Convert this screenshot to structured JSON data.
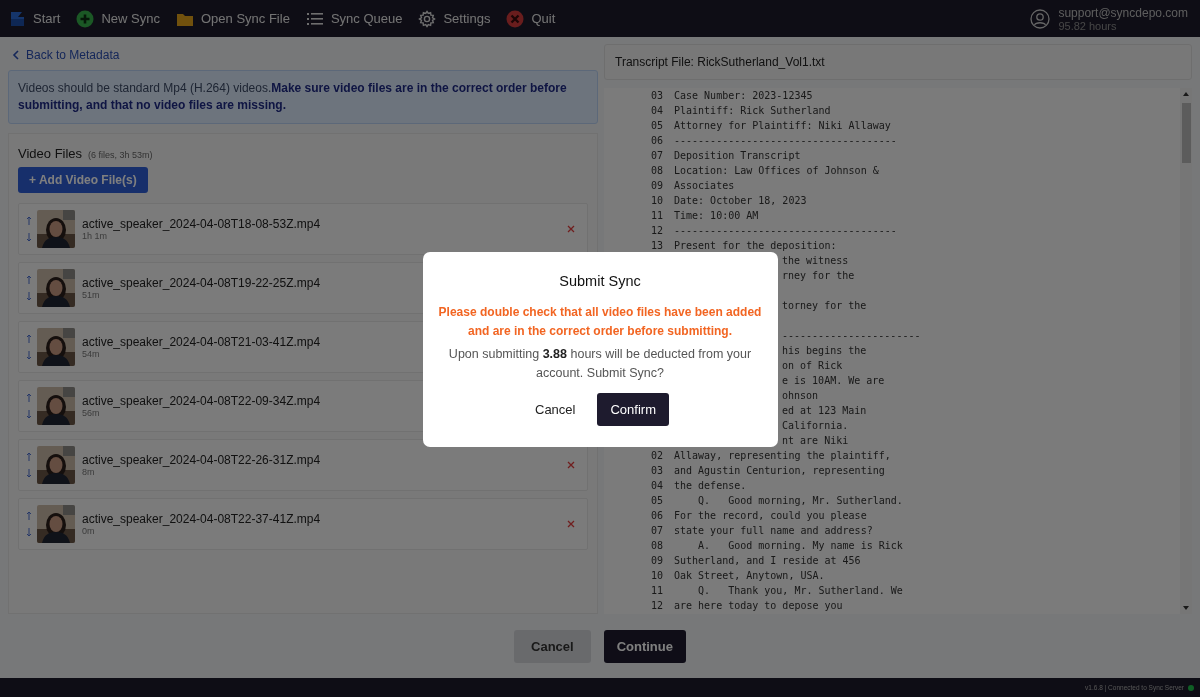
{
  "topbar": {
    "items": [
      {
        "kind": "logo",
        "label": "Start"
      },
      {
        "kind": "new",
        "label": "New Sync"
      },
      {
        "kind": "folder",
        "label": "Open Sync File"
      },
      {
        "kind": "list",
        "label": "Sync Queue"
      },
      {
        "kind": "gear",
        "label": "Settings"
      },
      {
        "kind": "quit",
        "label": "Quit"
      }
    ],
    "account": {
      "email": "support@syncdepo.com",
      "hours": "95.82 hours"
    }
  },
  "back_link": "Back to Metadata",
  "notice": "Videos should be standard Mp4 (H.264) videos.**Make sure video files are in the correct order before submitting, and that no video files are missing.**",
  "video_files": {
    "title": "Video Files",
    "summary": "(6 files, 3h 53m)",
    "add_button": "+ Add Video File(s)",
    "files": [
      {
        "name": "active_speaker_2024-04-08T18-08-53Z.mp4",
        "duration": "1h 1m",
        "remove_button": true
      },
      {
        "name": "active_speaker_2024-04-08T19-22-25Z.mp4",
        "duration": "51m",
        "remove_button": false
      },
      {
        "name": "active_speaker_2024-04-08T21-03-41Z.mp4",
        "duration": "54m",
        "remove_button": false
      },
      {
        "name": "active_speaker_2024-04-08T22-09-34Z.mp4",
        "duration": "56m",
        "remove_button": false
      },
      {
        "name": "active_speaker_2024-04-08T22-26-31Z.mp4",
        "duration": "8m",
        "remove_button": true
      },
      {
        "name": "active_speaker_2024-04-08T22-37-41Z.mp4",
        "duration": "0m",
        "remove_button": true
      }
    ]
  },
  "transcript": {
    "title": "Transcript File: RickSutherland_Vol1.txt",
    "lines": [
      {
        "kind": "line",
        "num": "03",
        "text": "Case Number: 2023-12345"
      },
      {
        "kind": "line",
        "num": "04",
        "text": "Plaintiff: Rick Sutherland"
      },
      {
        "kind": "line",
        "num": "05",
        "text": "Attorney for Plaintiff: Niki Allaway"
      },
      {
        "kind": "line",
        "num": "06",
        "text": "-------------------------------------"
      },
      {
        "kind": "line",
        "num": "07",
        "text": "Deposition Transcript"
      },
      {
        "kind": "line",
        "num": "08",
        "text": "Location: Law Offices of Johnson &"
      },
      {
        "kind": "line",
        "num": "09",
        "text": "Associates"
      },
      {
        "kind": "line",
        "num": "10",
        "text": "Date: October 18, 2023"
      },
      {
        "kind": "line",
        "num": "11",
        "text": "Time: 10:00 AM"
      },
      {
        "kind": "line",
        "num": "12",
        "text": "-------------------------------------"
      },
      {
        "kind": "line",
        "num": "13",
        "text": "Present for the deposition:"
      },
      {
        "kind": "partial",
        "text": "the witness"
      },
      {
        "kind": "partial",
        "text": "rney for the"
      },
      {
        "kind": "blank"
      },
      {
        "kind": "partial",
        "text": "torney for the"
      },
      {
        "kind": "blank"
      },
      {
        "kind": "partial",
        "text": "-----------------------"
      },
      {
        "kind": "partial",
        "text": "his begins the"
      },
      {
        "kind": "partial",
        "text": "on of Rick"
      },
      {
        "kind": "partial",
        "text": "e is 10AM. We are"
      },
      {
        "kind": "partial",
        "text": "ohnson"
      },
      {
        "kind": "partial",
        "text": "ed at 123 Main"
      },
      {
        "kind": "partial",
        "text": "California."
      },
      {
        "kind": "partial",
        "text": "nt are Niki"
      },
      {
        "kind": "line",
        "num": "02",
        "text": "Allaway, representing the plaintiff,"
      },
      {
        "kind": "line",
        "num": "03",
        "text": "and Agustin Centurion, representing"
      },
      {
        "kind": "line",
        "num": "04",
        "text": "the defense."
      },
      {
        "kind": "line",
        "num": "05",
        "text": "    Q.   Good morning, Mr. Sutherland."
      },
      {
        "kind": "line",
        "num": "06",
        "text": "For the record, could you please"
      },
      {
        "kind": "line",
        "num": "07",
        "text": "state your full name and address?"
      },
      {
        "kind": "line",
        "num": "08",
        "text": "    A.   Good morning. My name is Rick"
      },
      {
        "kind": "line",
        "num": "09",
        "text": "Sutherland, and I reside at 456"
      },
      {
        "kind": "line",
        "num": "10",
        "text": "Oak Street, Anytown, USA."
      },
      {
        "kind": "line",
        "num": "11",
        "text": "    Q.   Thank you, Mr. Sutherland. We"
      },
      {
        "kind": "line",
        "num": "12",
        "text": "are here today to depose you"
      }
    ]
  },
  "actions": {
    "cancel": "Cancel",
    "continue": "Continue"
  },
  "footer": {
    "status": "v1.6.8 | Connected to Sync Server",
    "connected": true
  },
  "modal": {
    "title": "Submit Sync",
    "warning": "Please double check that all video files have been added and are in the correct order before submitting.",
    "message": "Upon submitting **3.88** hours will be deducted from your account. Submit Sync?",
    "cancel": "Cancel",
    "confirm": "Confirm"
  }
}
